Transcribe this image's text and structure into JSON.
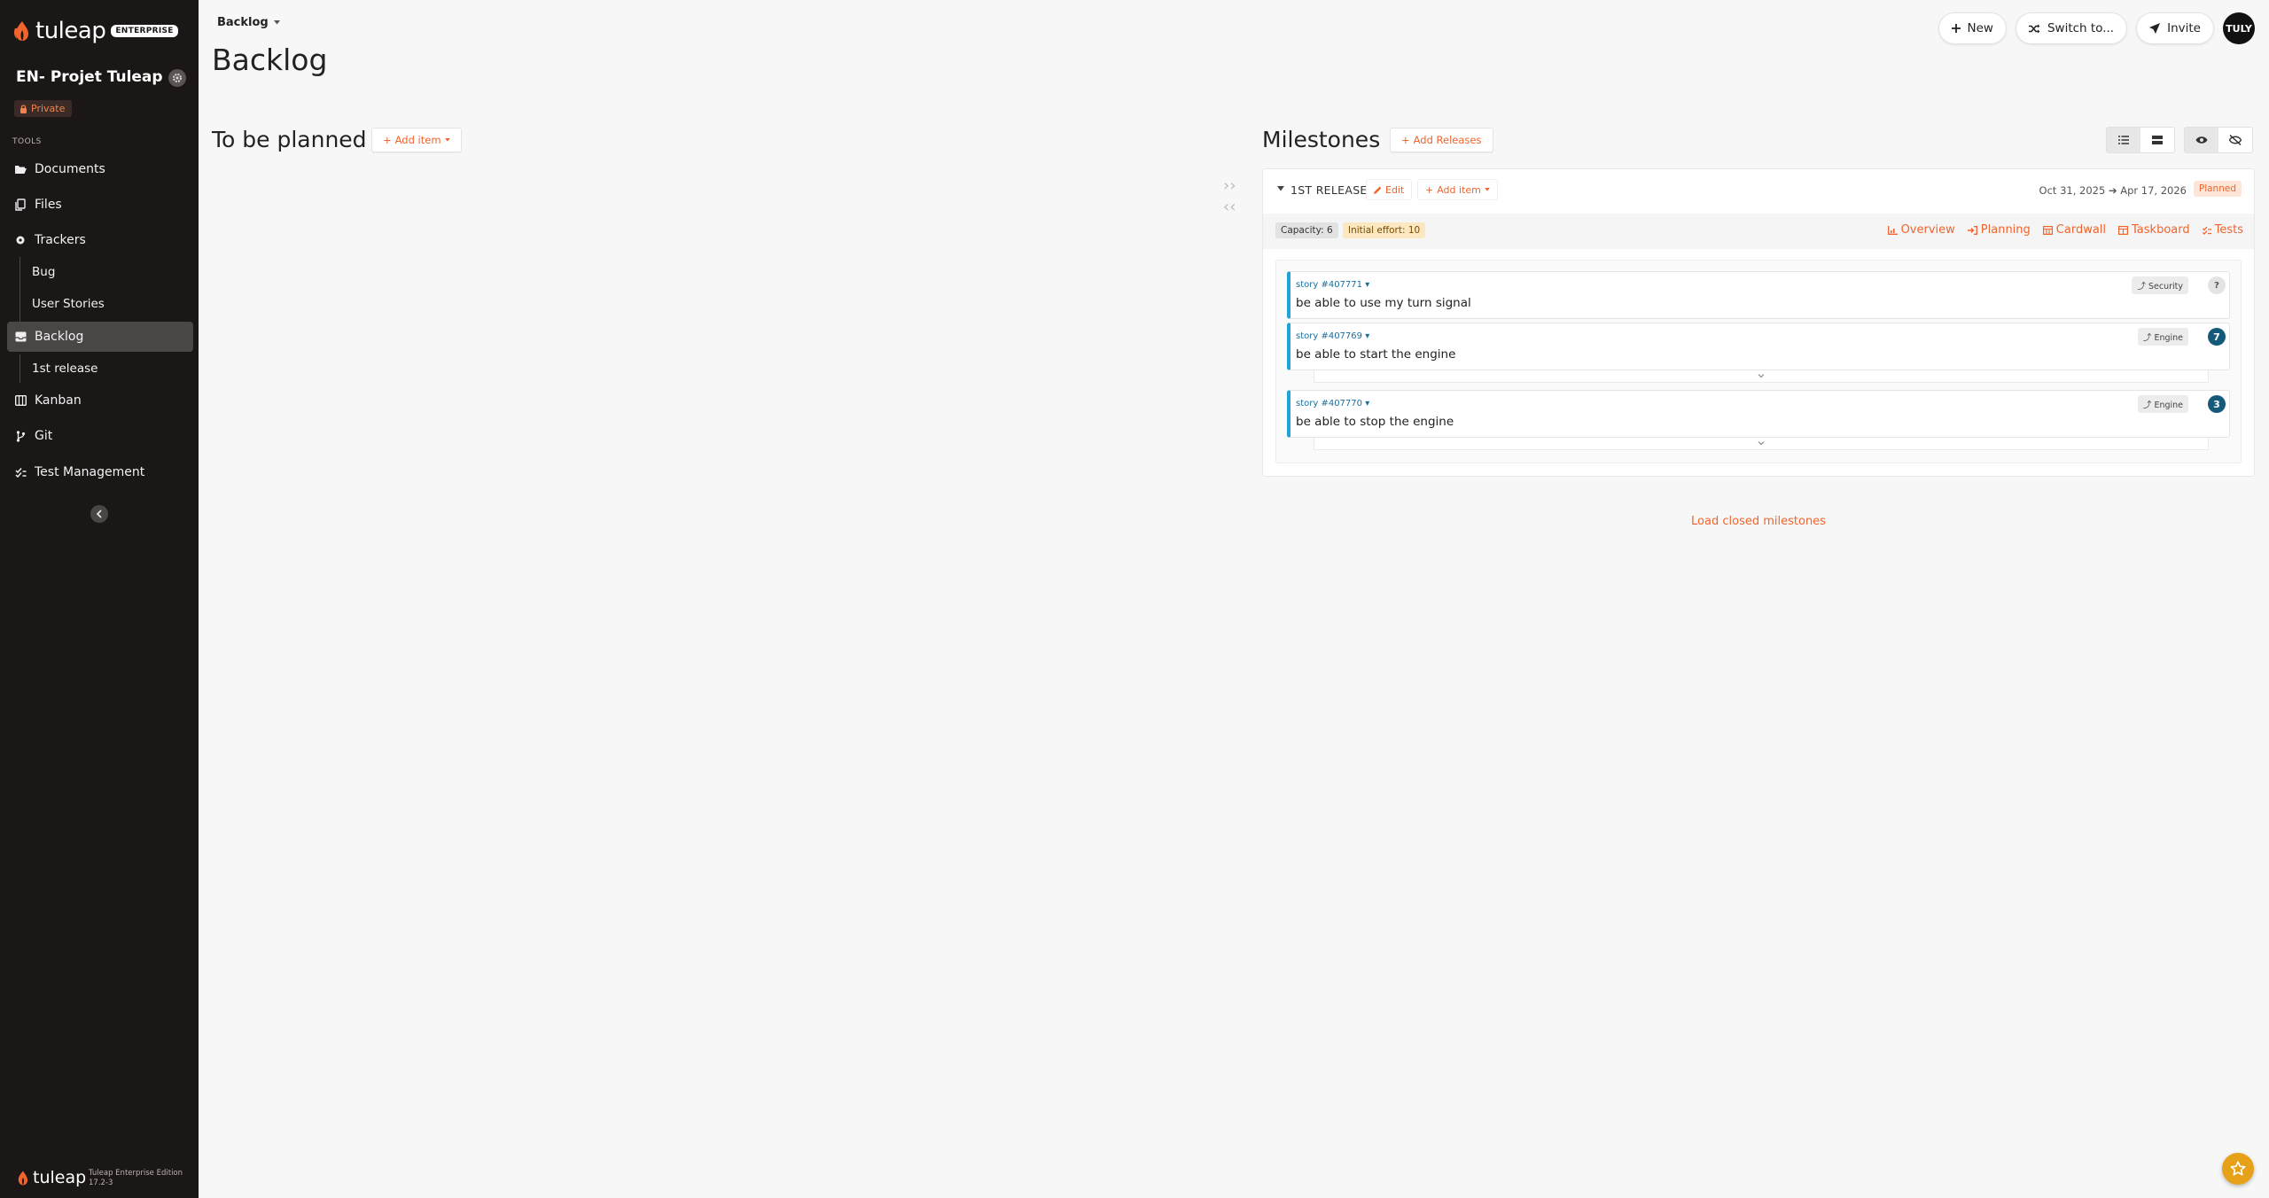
{
  "sidebar": {
    "logo_text": "tuleap",
    "logo_badge": "ENTERPRISE",
    "project_name": "EN- Projet Tuleap",
    "privacy": "Private",
    "tools_label": "TOOLS",
    "items": {
      "documents": "Documents",
      "files": "Files",
      "trackers": "Trackers",
      "bug": "Bug",
      "user_stories": "User Stories",
      "backlog": "Backlog",
      "first_release": "1st release",
      "kanban": "Kanban",
      "git": "Git",
      "test_management": "Test Management"
    },
    "footer_logo": "tuleap",
    "footer_edition": "Tuleap Enterprise Edition",
    "footer_version": "17.2-3"
  },
  "header": {
    "breadcrumb": "Backlog",
    "title": "Backlog",
    "new_label": "New",
    "switch_label": "Switch to...",
    "invite_label": "Invite",
    "avatar_initials": "TULY"
  },
  "to_be_planned": {
    "title": "To be planned",
    "add_item": "Add item"
  },
  "milestones": {
    "title": "Milestones",
    "add_releases": "Add Releases",
    "release": {
      "name": "1ST RELEASE",
      "edit": "Edit",
      "add_item": "Add item",
      "start_date": "Oct 31, 2025",
      "end_date": "Apr 17, 2026",
      "status": "Planned",
      "capacity": "Capacity: 6",
      "initial_effort": "Initial effort: 10",
      "links": {
        "overview": "Overview",
        "planning": "Planning",
        "cardwall": "Cardwall",
        "taskboard": "Taskboard",
        "tests": "Tests"
      },
      "items": [
        {
          "id": "story #407771",
          "title": "be able to use my turn signal",
          "tag": "Security",
          "points": "?"
        },
        {
          "id": "story #407769",
          "title": "be able to start the engine",
          "tag": "Engine",
          "points": "7"
        },
        {
          "id": "story #407770",
          "title": "be able to stop the engine",
          "tag": "Engine",
          "points": "3"
        }
      ]
    },
    "load_closed": "Load closed milestones"
  },
  "colors": {
    "accent": "#f0642d",
    "sidebar_bg": "#1b1716",
    "card_border": "#1fa3d8",
    "points_bg": "#155a7a"
  }
}
